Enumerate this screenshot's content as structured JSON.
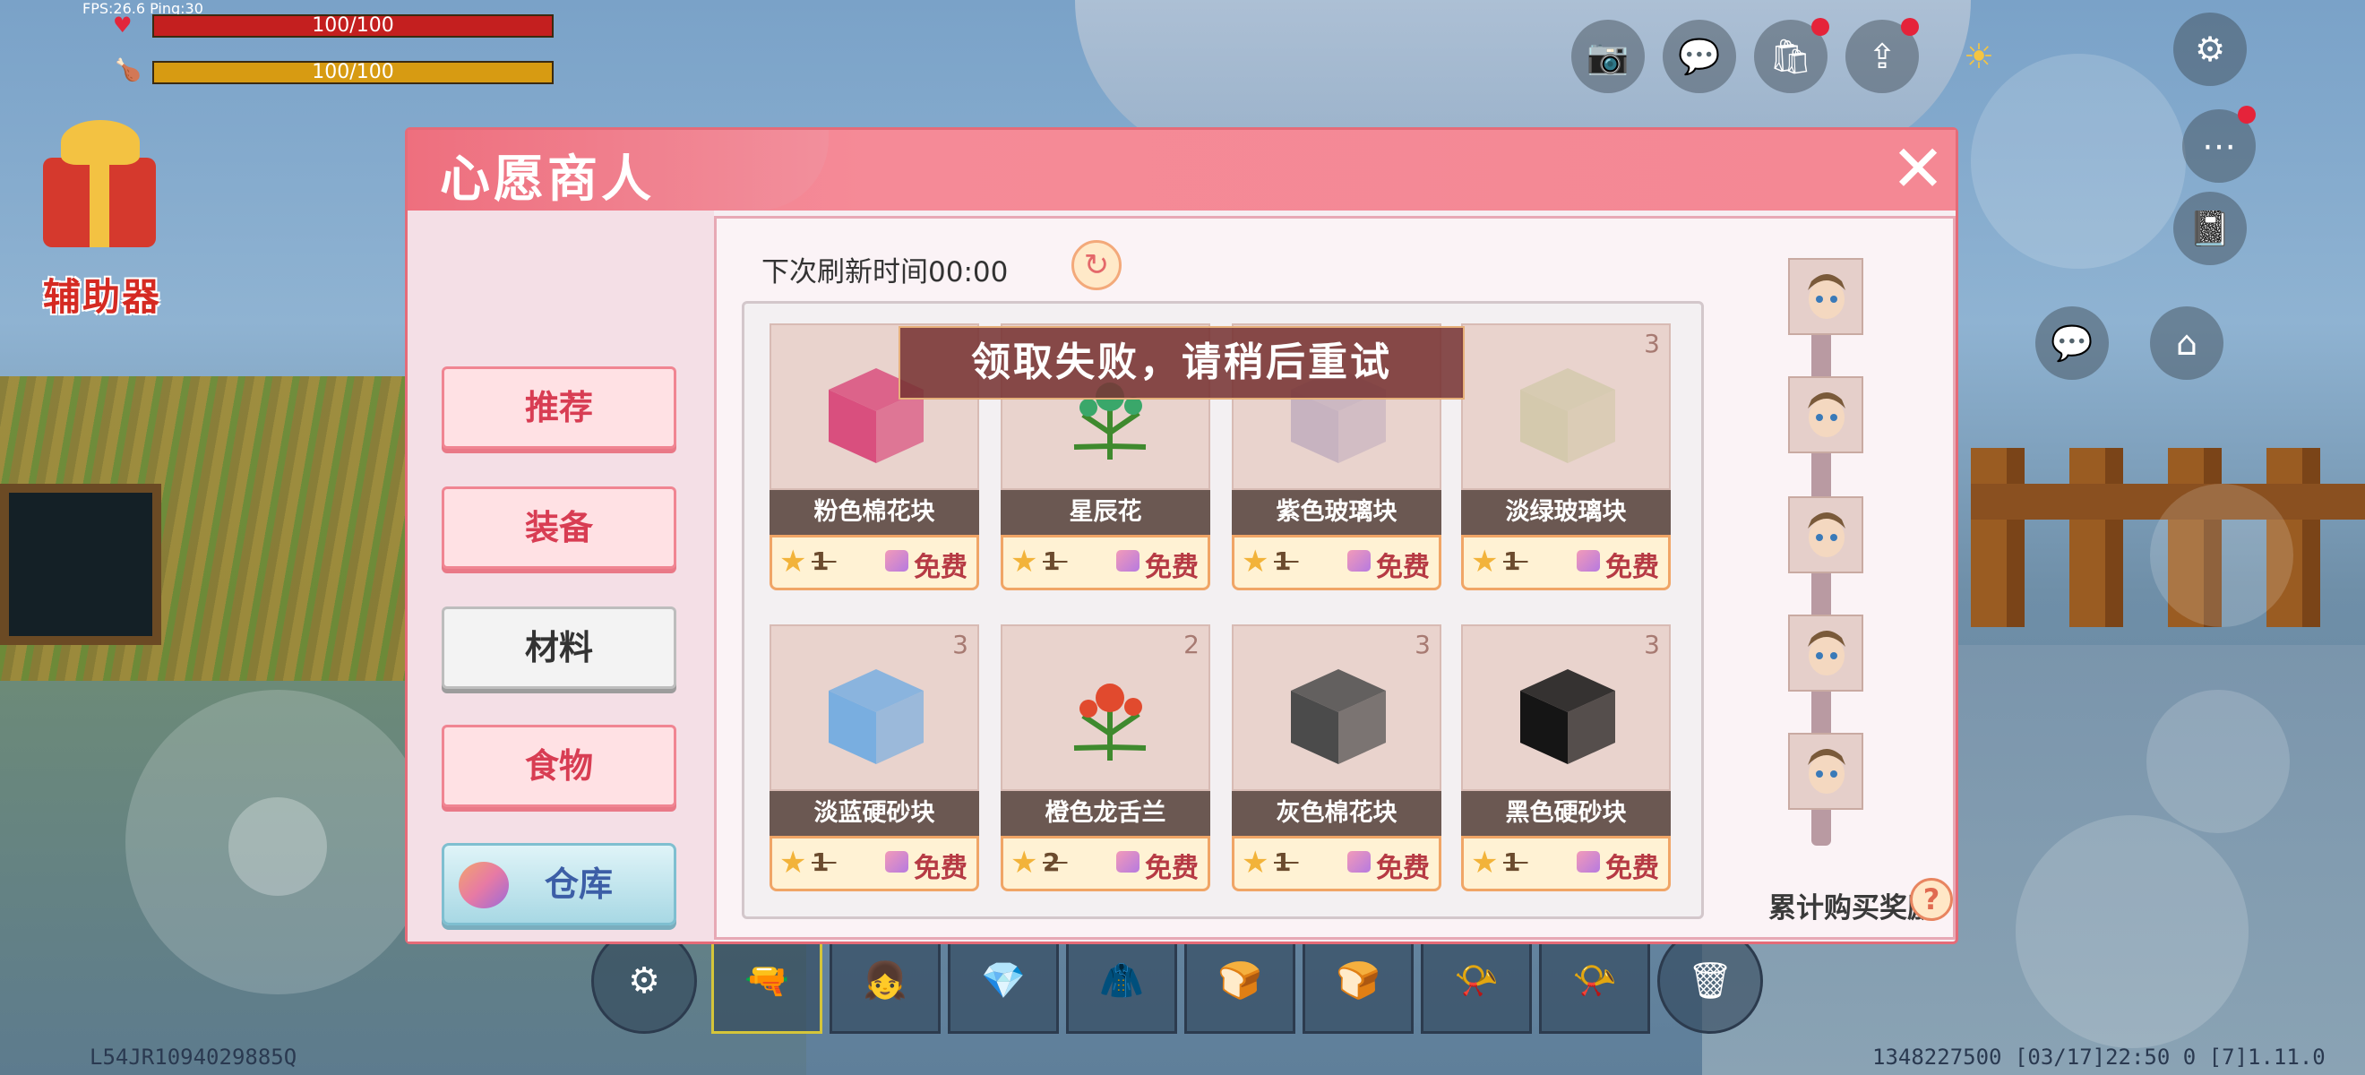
{
  "hud": {
    "fps_ping": "FPS:26.6  Ping:30",
    "health": "100/100",
    "hunger": "100/100",
    "helper_label": "辅助器",
    "player_id": "L54JR1094029885Q",
    "status_line": "1348227500   [03/17]22:50 0   [7]1.11.0"
  },
  "dialog": {
    "title": "心愿商人",
    "close_icon": "close-icon",
    "categories": [
      {
        "label": "推荐",
        "active": false
      },
      {
        "label": "装备",
        "active": false
      },
      {
        "label": "材料",
        "active": true
      },
      {
        "label": "食物",
        "active": false
      }
    ],
    "warehouse_label": "仓库",
    "refresh_label": "下次刷新时间00:00",
    "toast": "领取失败，请稍后重试",
    "reward_label": "累计购买奖励",
    "reward_nodes": 5,
    "items": [
      {
        "name": "粉色棉花块",
        "count": "",
        "price": "1",
        "free": "免费",
        "color": "#d94f7e",
        "kind": "cube"
      },
      {
        "name": "星辰花",
        "count": "",
        "price": "1",
        "free": "免费",
        "color": "#3aa76a",
        "kind": "flower"
      },
      {
        "name": "紫色玻璃块",
        "count": "",
        "price": "1",
        "free": "免费",
        "color": "#c7b3c0",
        "kind": "cube"
      },
      {
        "name": "淡绿玻璃块",
        "count": "3",
        "price": "1",
        "free": "免费",
        "color": "#d4c9ad",
        "kind": "cube"
      },
      {
        "name": "淡蓝硬砂块",
        "count": "3",
        "price": "1",
        "free": "免费",
        "color": "#79aee0",
        "kind": "cube"
      },
      {
        "name": "橙色龙舌兰",
        "count": "2",
        "price": "2",
        "free": "免费",
        "color": "#e14a2e",
        "kind": "flower"
      },
      {
        "name": "灰色棉花块",
        "count": "3",
        "price": "1",
        "free": "免费",
        "color": "#4b4b4b",
        "kind": "cube"
      },
      {
        "name": "黑色硬砂块",
        "count": "3",
        "price": "1",
        "free": "免费",
        "color": "#151515",
        "kind": "cube"
      }
    ]
  },
  "hotbar": {
    "slots": [
      "⚙",
      "🔫",
      "👧",
      "💎",
      "🧥",
      "🍞",
      "🍞",
      "📯",
      "📯",
      "🗑"
    ]
  },
  "colors": {
    "accent": "#f27e8b",
    "toast_bg": "#783434",
    "free_text": "#b63a44"
  }
}
